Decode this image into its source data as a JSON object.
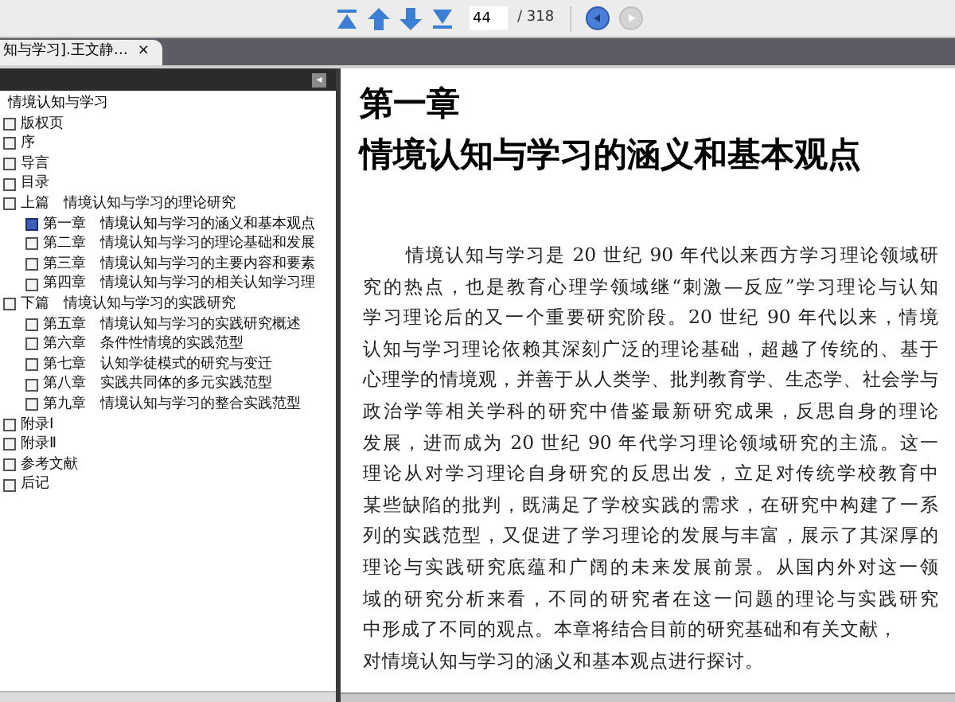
{
  "toolbar": {
    "nav_buttons": [
      {
        "kind": "first",
        "disabled": false
      },
      {
        "kind": "prev",
        "disabled": false
      },
      {
        "kind": "next",
        "disabled": false
      },
      {
        "kind": "last",
        "disabled": false
      }
    ],
    "page_input": "44",
    "page_total": "/ 318",
    "action_buttons": [
      {
        "kind": "go",
        "disabled": false
      },
      {
        "kind": "forward",
        "disabled": true
      }
    ]
  },
  "tabs": [
    {
      "label": "知与学习].王文静…",
      "selected": true,
      "close": "×"
    }
  ],
  "sidebar": {
    "collapse": "◂",
    "tree": {
      "label": "情境认知与学习",
      "children": [
        {
          "label": "版权页",
          "selected": false
        },
        {
          "label": "序",
          "selected": false
        },
        {
          "label": "导言",
          "selected": false
        },
        {
          "label": "目录",
          "selected": false
        },
        {
          "label": "上篇　情境认知与学习的理论研究",
          "selected": false,
          "children": [
            {
              "label": "第一章　情境认知与学习的涵义和基本观点",
              "selected": true
            },
            {
              "label": "第二章　情境认知与学习的理论基础和发展",
              "selected": false
            },
            {
              "label": "第三章　情境认知与学习的主要内容和要素",
              "selected": false
            },
            {
              "label": "第四章　情境认知与学习的相关认知学习理",
              "selected": false
            }
          ]
        },
        {
          "label": "下篇　情境认知与学习的实践研究",
          "selected": false,
          "children": [
            {
              "label": "第五章　情境认知与学习的实践研究概述",
              "selected": false
            },
            {
              "label": "第六章　条件性情境的实践范型",
              "selected": false
            },
            {
              "label": "第七章　认知学徒模式的研究与变迁",
              "selected": false
            },
            {
              "label": "第八章　实践共同体的多元实践范型",
              "selected": false
            },
            {
              "label": "第九章　情境认知与学习的整合实践范型",
              "selected": false
            }
          ]
        },
        {
          "label": "附录Ⅰ",
          "selected": false
        },
        {
          "label": "附录Ⅱ",
          "selected": false
        },
        {
          "label": "参考文献",
          "selected": false
        },
        {
          "label": "后记",
          "selected": false
        }
      ]
    }
  },
  "page": {
    "chapter": "第一章",
    "title": "情境认知与学习的涵义和基本观点",
    "paragraph_lines": [
      "情境认知与学习是 20 世纪 90 年代以来西方学习理论领域研",
      "究的热点，也是教育心理学领域继“刺激—反应”学习理论与认知",
      "学习理论后的又一个重要研究阶段。20 世纪 90 年代以来，情境",
      "认知与学习理论依赖其深刻广泛的理论基础，超越了传统的、基于",
      "心理学的情境观，并善于从人类学、批判教育学、生态学、社会学与",
      "政治学等相关学科的研究中借鉴最新研究成果，反思自身的理论",
      "发展，进而成为 20 世纪 90 年代学习理论领域研究的主流。这一",
      "理论从对学习理论自身研究的反思出发，立足对传统学校教育中",
      "某些缺陷的批判，既满足了学校实践的需求，在研究中构建了一系",
      "列的实践范型，又促进了学习理论的发展与丰富，展示了其深厚的",
      "理论与实践研究底蕴和广阔的未来发展前景。从国内外对这一领",
      "域的研究分析来看，不同的研究者在这一问题的理论与实践研究",
      "中形成了不同的观点。本章将结合目前的研究基础和有关文献，",
      "对情境认知与学习的涵义和基本观点进行探讨。"
    ]
  }
}
